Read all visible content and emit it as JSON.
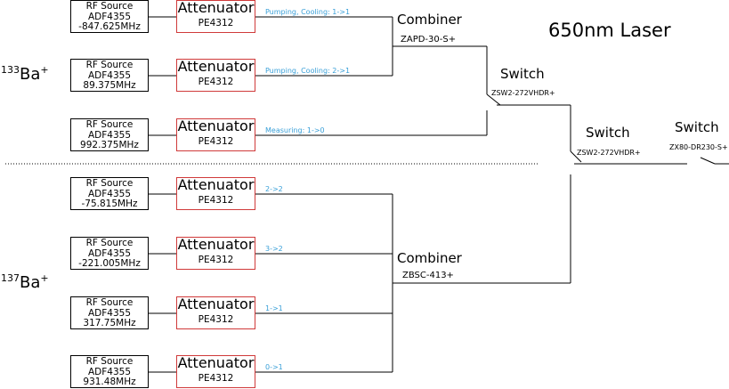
{
  "title": "650nm Laser",
  "ions": {
    "ba133": {
      "mass": "133",
      "symbol": "Ba",
      "charge": "+"
    },
    "ba137": {
      "mass": "137",
      "symbol": "Ba",
      "charge": "+"
    }
  },
  "channels": [
    {
      "rf_title": "RF Source",
      "rf_model": "ADF4355",
      "rf_freq": "-847.625MHz",
      "att_title": "Attenuator",
      "att_model": "PE4312",
      "signal": "Pumping, Cooling: 1->1"
    },
    {
      "rf_title": "RF Source",
      "rf_model": "ADF4355",
      "rf_freq": "89.375MHz",
      "att_title": "Attenuator",
      "att_model": "PE4312",
      "signal": "Pumping, Cooling: 2->1"
    },
    {
      "rf_title": "RF Source",
      "rf_model": "ADF4355",
      "rf_freq": "992.375MHz",
      "att_title": "Attenuator",
      "att_model": "PE4312",
      "signal": "Measuring: 1->0"
    },
    {
      "rf_title": "RF Source",
      "rf_model": "ADF4355",
      "rf_freq": "-75.815MHz",
      "att_title": "Attenuator",
      "att_model": "PE4312",
      "signal": "2->2"
    },
    {
      "rf_title": "RF Source",
      "rf_model": "ADF4355",
      "rf_freq": "-221.005MHz",
      "att_title": "Attenuator",
      "att_model": "PE4312",
      "signal": "3->2"
    },
    {
      "rf_title": "RF Source",
      "rf_model": "ADF4355",
      "rf_freq": "317.75MHz",
      "att_title": "Attenuator",
      "att_model": "PE4312",
      "signal": "1->1"
    },
    {
      "rf_title": "RF Source",
      "rf_model": "ADF4355",
      "rf_freq": "931.48MHz",
      "att_title": "Attenuator",
      "att_model": "PE4312",
      "signal": "0->1"
    }
  ],
  "combiner1": {
    "title": "Combiner",
    "model": "ZAPD-30-S+"
  },
  "combiner2": {
    "title": "Combiner",
    "model": "ZBSC-413+"
  },
  "switch1": {
    "title": "Switch",
    "model": "ZSW2-272VHDR+"
  },
  "switch2": {
    "title": "Switch",
    "model": "ZSW2-272VHDR+"
  },
  "switch3": {
    "title": "Switch",
    "model": "ZX80-DR230-S+"
  },
  "colors": {
    "attenuator_border": "#d03a3a",
    "signal_label": "#3aa0d8",
    "line": "#000000"
  }
}
